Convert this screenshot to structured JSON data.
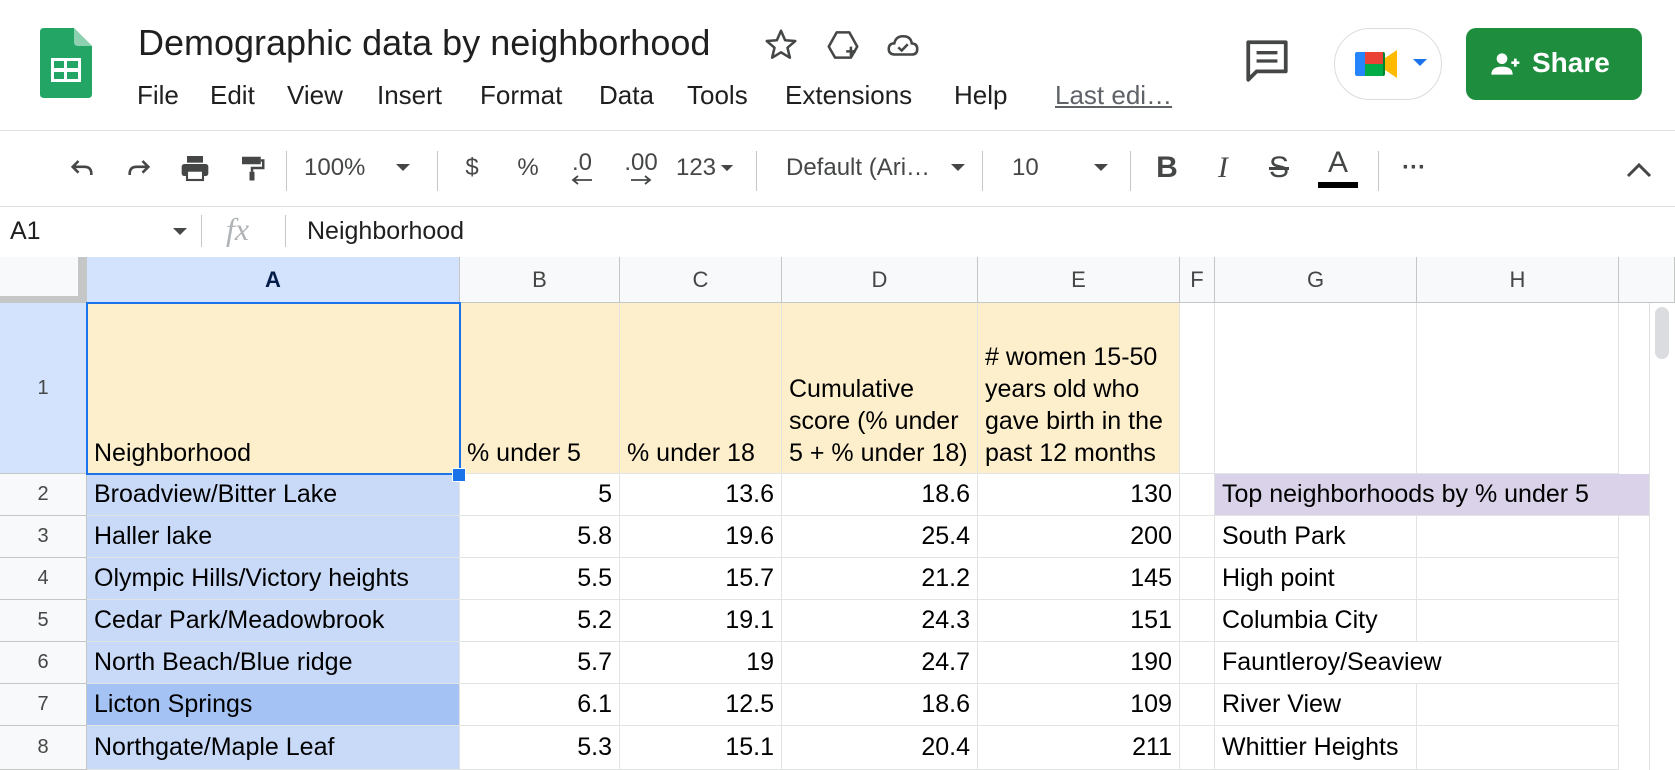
{
  "app": {
    "doc_title": "Demographic data by neighborhood",
    "menu": [
      "File",
      "Edit",
      "View",
      "Insert",
      "Format",
      "Data",
      "Tools",
      "Extensions",
      "Help"
    ],
    "last_edit": "Last edi…",
    "share_label": "Share"
  },
  "toolbar": {
    "zoom": "100%",
    "currency": "$",
    "percent": "%",
    "decrease_decimal": ".0",
    "increase_decimal": ".00",
    "more_formats": "123",
    "font": "Default (Ari…",
    "font_size": "10",
    "bold": "B",
    "italic": "I",
    "strikethrough": "S",
    "text_color": "A",
    "more": "···",
    "text_color_value": "#000000"
  },
  "formula_bar": {
    "cell_ref": "A1",
    "fx": "fx",
    "content": "Neighborhood"
  },
  "grid": {
    "columns": [
      "A",
      "B",
      "C",
      "D",
      "E",
      "F",
      "G",
      "H"
    ],
    "rows": [
      "1",
      "2",
      "3",
      "4",
      "5",
      "6",
      "7",
      "8"
    ],
    "header_row": {
      "a": "Neighborhood",
      "b": "% under 5",
      "c": "% under 18",
      "d": "Cumulative score (% under 5 + % under 18)",
      "e": "# women 15-50 years old who gave birth in the past 12 months"
    },
    "data_rows": [
      {
        "a": "Broadview/Bitter Lake",
        "b": "5",
        "c": "13.6",
        "d": "18.6",
        "e": "130",
        "g": "Top neighborhoods by % under 5"
      },
      {
        "a": "Haller lake",
        "b": "5.8",
        "c": "19.6",
        "d": "25.4",
        "e": "200",
        "g": "South Park"
      },
      {
        "a": "Olympic Hills/Victory heights",
        "b": "5.5",
        "c": "15.7",
        "d": "21.2",
        "e": "145",
        "g": "High point"
      },
      {
        "a": "Cedar Park/Meadowbrook",
        "b": "5.2",
        "c": "19.1",
        "d": "24.3",
        "e": "151",
        "g": "Columbia City"
      },
      {
        "a": "North Beach/Blue ridge",
        "b": "5.7",
        "c": "19",
        "d": "24.7",
        "e": "190",
        "g": "Fauntleroy/Seaview"
      },
      {
        "a": "Licton Springs",
        "b": "6.1",
        "c": "12.5",
        "d": "18.6",
        "e": "109",
        "g": "River View"
      },
      {
        "a": "Northgate/Maple Leaf",
        "b": "5.3",
        "c": "15.1",
        "d": "20.4",
        "e": "211",
        "g": "Whittier Heights"
      }
    ]
  },
  "colors": {
    "header_fill": "#fdefcc",
    "neighborhood_fill": "#c9daf8",
    "highlight_fill": "#a4c2f4",
    "label_fill": "#d9d2e9",
    "selection": "#1a73e8",
    "share_button": "#1e8e3e"
  }
}
